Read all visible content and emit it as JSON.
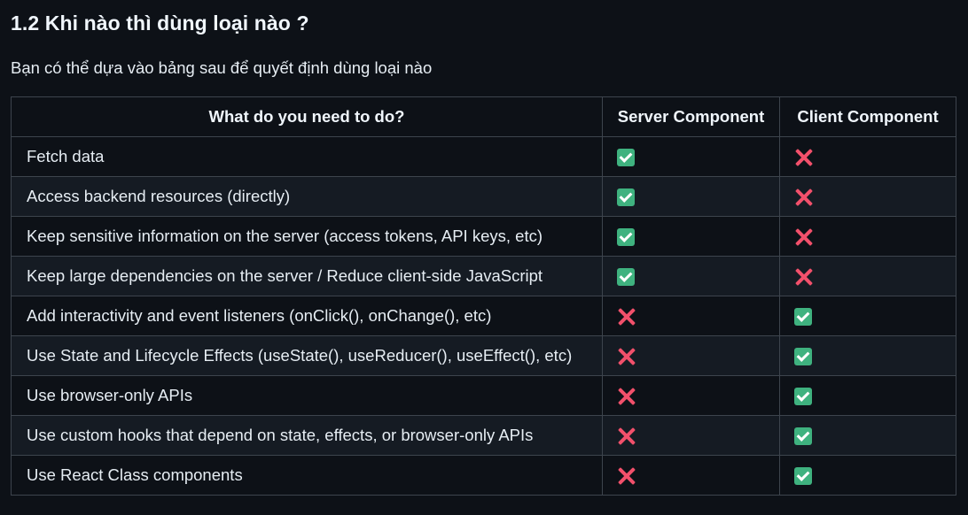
{
  "section": {
    "title": "1.2 Khi nào thì dùng loại nào ?",
    "intro": "Bạn có thể dựa vào bảng sau để quyết định dùng loại nào"
  },
  "table": {
    "headers": [
      "What do you need to do?",
      "Server Component",
      "Client Component"
    ],
    "rows": [
      {
        "task": "Fetch data",
        "server": "check",
        "client": "cross"
      },
      {
        "task": "Access backend resources (directly)",
        "server": "check",
        "client": "cross"
      },
      {
        "task": "Keep sensitive information on the server (access tokens, API keys, etc)",
        "server": "check",
        "client": "cross"
      },
      {
        "task": "Keep large dependencies on the server / Reduce client-side JavaScript",
        "server": "check",
        "client": "cross"
      },
      {
        "task": "Add interactivity and event listeners (onClick(), onChange(), etc)",
        "server": "cross",
        "client": "check"
      },
      {
        "task": "Use State and Lifecycle Effects (useState(), useReducer(), useEffect(), etc)",
        "server": "cross",
        "client": "check"
      },
      {
        "task": "Use browser-only APIs",
        "server": "cross",
        "client": "check"
      },
      {
        "task": "Use custom hooks that depend on state, effects, or browser-only APIs",
        "server": "cross",
        "client": "check"
      },
      {
        "task": "Use React Class components",
        "server": "cross",
        "client": "check"
      }
    ]
  },
  "colors": {
    "background": "#0d1117",
    "row_alt": "#151b23",
    "border": "#3d444d",
    "check": "#3fb27f",
    "cross": "#f2506b"
  }
}
